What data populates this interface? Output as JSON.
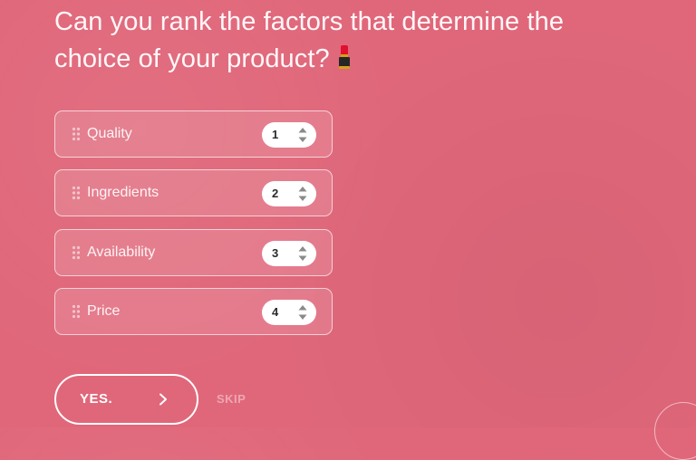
{
  "question": {
    "text": "Can you rank the factors that determine the choice of your product?",
    "emoji": "lipstick-icon"
  },
  "ranking": {
    "items": [
      {
        "label": "Quality",
        "rank": "1"
      },
      {
        "label": "Ingredients",
        "rank": "2"
      },
      {
        "label": "Availability",
        "rank": "3"
      },
      {
        "label": "Price",
        "rank": "4"
      }
    ]
  },
  "actions": {
    "submit_label": "YES.",
    "skip_label": "SKIP"
  },
  "colors": {
    "background": "#e0677a",
    "text": "#ffffff",
    "select_text": "#2b2b2b"
  }
}
